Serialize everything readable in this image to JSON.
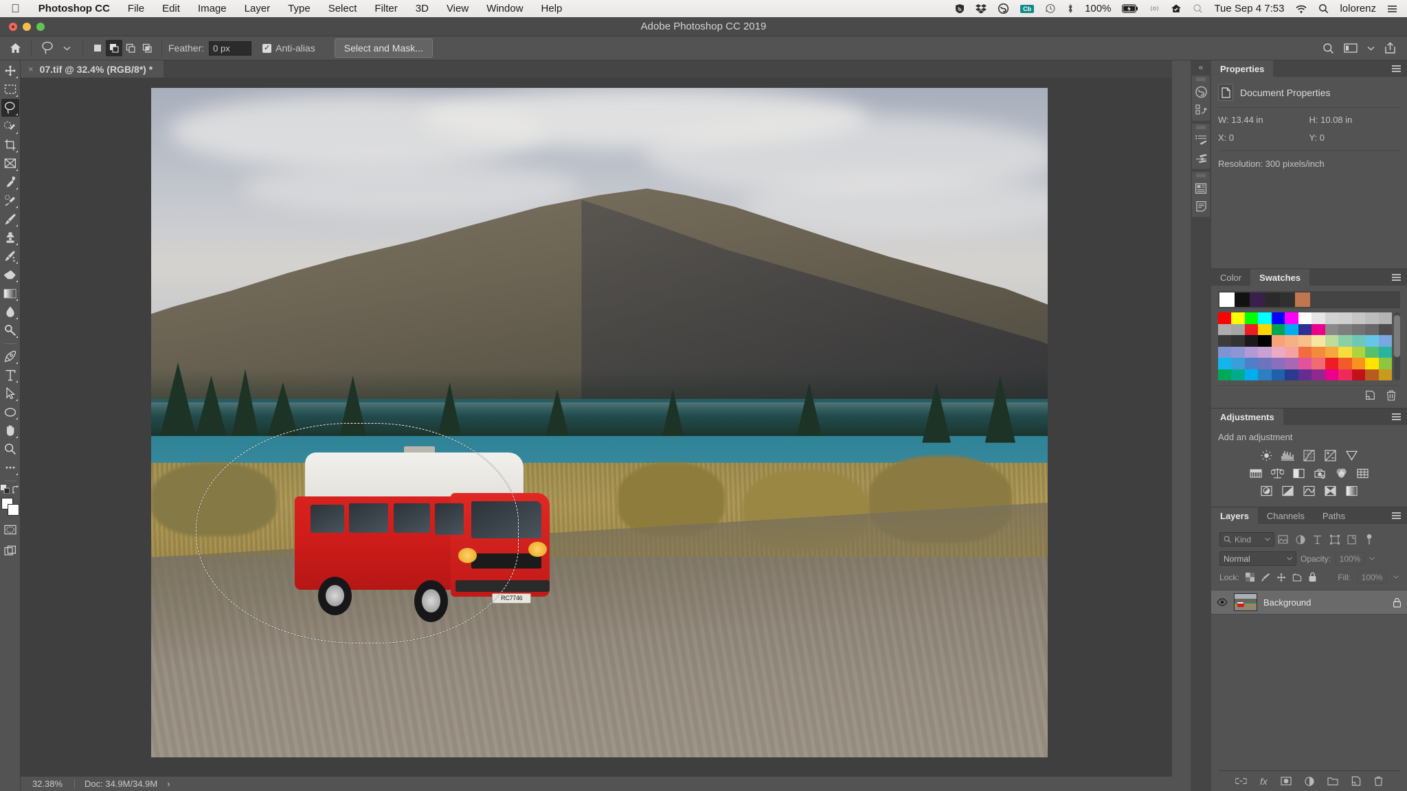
{
  "menubar": {
    "apple": "",
    "app_name": "Photoshop CC",
    "items": [
      "File",
      "Edit",
      "Image",
      "Layer",
      "Type",
      "Select",
      "Filter",
      "3D",
      "View",
      "Window",
      "Help"
    ],
    "battery_percent": "100%",
    "datetime": "Tue Sep 4  7:53",
    "user": "lolorenz",
    "cb_badge": "Cb",
    "icons": [
      "vpn-shield-icon",
      "dropbox-icon",
      "creative-cloud-icon",
      "colorburn-icon",
      "time-machine-icon",
      "bluetooth-icon",
      "battery-icon",
      "airplay-icon",
      "cleanmymac-icon",
      "spotlight-icon",
      "wifi-icon",
      "search-icon",
      "user-icon",
      "control-center-icon"
    ]
  },
  "window": {
    "title": "Adobe Photoshop CC 2019"
  },
  "options_bar": {
    "home_icon": "home-icon",
    "tool_icon": "lasso-tool-icon",
    "selection_modes": [
      "new-selection",
      "add-to-selection",
      "subtract-from-selection",
      "intersect-selection"
    ],
    "active_selection_mode": 1,
    "feather_label": "Feather:",
    "feather_value": "0 px",
    "antialias_label": "Anti-alias",
    "antialias_checked": true,
    "select_and_mask_label": "Select and Mask...",
    "right_icons": [
      "search-icon",
      "workspace-switcher-icon",
      "share-icon"
    ]
  },
  "document_tab": {
    "close_glyph": "×",
    "label": "07.tif @ 32.4% (RGB/8*) *"
  },
  "toolbar": {
    "tools": [
      {
        "name": "move-tool",
        "active": false
      },
      {
        "name": "rectangular-marquee-tool",
        "active": false
      },
      {
        "name": "lasso-tool",
        "active": true
      },
      {
        "name": "quick-selection-tool",
        "active": false
      },
      {
        "name": "crop-tool",
        "active": false
      },
      {
        "name": "frame-tool",
        "active": false
      },
      {
        "name": "eyedropper-tool",
        "active": false
      },
      {
        "name": "spot-healing-brush-tool",
        "active": false
      },
      {
        "name": "brush-tool",
        "active": false
      },
      {
        "name": "clone-stamp-tool",
        "active": false
      },
      {
        "name": "history-brush-tool",
        "active": false
      },
      {
        "name": "eraser-tool",
        "active": false
      },
      {
        "name": "gradient-tool",
        "active": false
      },
      {
        "name": "blur-tool",
        "active": false
      },
      {
        "name": "dodge-tool",
        "active": false
      },
      {
        "name": "pen-tool",
        "active": false
      },
      {
        "name": "type-tool",
        "active": false
      },
      {
        "name": "path-selection-tool",
        "active": false
      },
      {
        "name": "ellipse-tool",
        "active": false
      },
      {
        "name": "hand-tool",
        "active": false
      },
      {
        "name": "zoom-tool",
        "active": false
      },
      {
        "name": "edit-toolbar-tool",
        "active": false
      }
    ],
    "foreground_color": "#ffffff",
    "background_color": "#ffffff",
    "quick_mask": "quick-mask-icon",
    "screen_mode": "screen-mode-icon"
  },
  "canvas": {
    "image_alt": "red-vw-campervan-by-lake-and-mountain",
    "license_plate": "RC7746",
    "selection": "lasso-marching-ants-selection"
  },
  "status_bar": {
    "zoom": "32.38%",
    "doc_info": "Doc: 34.9M/34.9M",
    "expand_glyph": "›"
  },
  "dock_rail": {
    "collapse_glyph": "«",
    "icons": [
      "creative-cloud-libraries-icon",
      "export-icon",
      "brush-settings-icon",
      "brush-presets-icon",
      "notes-icon",
      "properties-icon"
    ]
  },
  "properties_panel": {
    "tab": "Properties",
    "doc_properties_label": "Document Properties",
    "fields": [
      {
        "label": "W:",
        "value": "13.44 in"
      },
      {
        "label": "H:",
        "value": "10.08 in"
      },
      {
        "label": "X:",
        "value": "0"
      },
      {
        "label": "Y:",
        "value": "0"
      }
    ],
    "resolution": "Resolution: 300 pixels/inch"
  },
  "swatches_panel": {
    "tabs": [
      "Color",
      "Swatches"
    ],
    "active_tab": "Swatches",
    "recent": [
      "#ffffff",
      "#111111",
      "#3b1f4b",
      "#2a2a2a",
      "#303030",
      "#c0764f"
    ],
    "grid": [
      [
        "#fe0000",
        "#ffff00",
        "#00ff00",
        "#00ffff",
        "#0000ff",
        "#ff00ff",
        "#ffffff",
        "#e6e6e6",
        "#d2d2d2",
        "#cfcfcf",
        "#c6c6c6",
        "#bdbdbd",
        "#b4b4b4"
      ],
      [
        "#adadad",
        "#a6a6a6",
        "#ee1c24",
        "#ffd400",
        "#00a651",
        "#00aeef",
        "#2e3192",
        "#ec008c",
        "#8a8a8a",
        "#7e7e7e",
        "#737373",
        "#686868",
        "#4d4d4d"
      ],
      [
        "#3c3c3c",
        "#333333",
        "#1a1a1a",
        "#000000",
        "#f7a278",
        "#f5b183",
        "#f7c08a",
        "#f6e6a0",
        "#bfdc9a",
        "#8ccfa6",
        "#6fc8b4",
        "#67c6e8",
        "#7aa7e0"
      ],
      [
        "#8094d4",
        "#9095d8",
        "#b39ad6",
        "#caa0d2",
        "#eeaac4",
        "#f4a3a3",
        "#f26c3e",
        "#f38b3c",
        "#f5a93c",
        "#f7de3c",
        "#aed33f",
        "#58c06a",
        "#2ab4a0"
      ],
      [
        "#13b5ea",
        "#3a9fd8",
        "#4f7fc6",
        "#6b74bd",
        "#8a6fbc",
        "#a868b4",
        "#e2539b",
        "#ef6c73",
        "#ee1c24",
        "#f15a29",
        "#f7931e",
        "#ffe400",
        "#8ec63f"
      ],
      [
        "#00a859",
        "#00aa8d",
        "#00aeef",
        "#2c7fc0",
        "#1f62ab",
        "#2a3b8f",
        "#662d91",
        "#92278f",
        "#ec008c",
        "#ee2a5b",
        "#c1121c",
        "#b85c1d",
        "#c99a1d"
      ]
    ],
    "footer_icons": [
      "new-swatch-icon",
      "delete-swatch-icon"
    ]
  },
  "adjustments_panel": {
    "tab": "Adjustments",
    "label": "Add an adjustment",
    "rows": [
      [
        "brightness-contrast-icon",
        "levels-icon",
        "curves-icon",
        "exposure-icon",
        "vibrance-icon"
      ],
      [
        "hue-saturation-icon",
        "color-balance-icon",
        "black-white-icon",
        "photo-filter-icon",
        "channel-mixer-icon",
        "color-lookup-icon"
      ],
      [
        "invert-icon",
        "posterize-icon",
        "threshold-icon",
        "selective-color-icon",
        "gradient-map-icon"
      ]
    ]
  },
  "layers_panel": {
    "tabs": [
      "Layers",
      "Channels",
      "Paths"
    ],
    "active_tab": "Layers",
    "filter_label": "Kind",
    "filter_icons": [
      "filter-pixel-icon",
      "filter-adjustment-icon",
      "filter-type-icon",
      "filter-shape-icon",
      "filter-smart-object-icon",
      "filter-toggle-icon"
    ],
    "blend_mode": "Normal",
    "opacity_label": "Opacity:",
    "opacity_value": "100%",
    "lock_label": "Lock:",
    "lock_icons": [
      "lock-transparent-pixels-icon",
      "lock-image-pixels-icon",
      "lock-position-icon",
      "lock-artboard-nesting-icon",
      "lock-all-icon"
    ],
    "fill_label": "Fill:",
    "fill_value": "100%",
    "layers": [
      {
        "name": "Background",
        "visible": true,
        "locked": true,
        "thumbnail": "campervan-thumbnail"
      }
    ],
    "footer_icons": [
      "link-layers-icon",
      "layer-style-icon",
      "layer-mask-icon",
      "new-fill-adjustment-icon",
      "new-group-icon",
      "new-layer-icon",
      "delete-layer-icon"
    ]
  }
}
